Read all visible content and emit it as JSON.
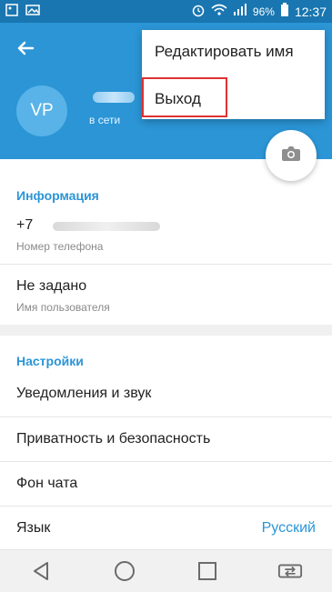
{
  "status_bar": {
    "battery": "96%",
    "time": "12:37"
  },
  "profile": {
    "avatar_initials": "VP",
    "status": "в сети"
  },
  "menu": {
    "edit_name": "Редактировать имя",
    "logout": "Выход"
  },
  "info_section": {
    "title": "Информация",
    "phone_prefix": "+7",
    "phone_label": "Номер телефона",
    "username_value": "Не задано",
    "username_label": "Имя пользователя"
  },
  "settings_section": {
    "title": "Настройки",
    "items": [
      {
        "label": "Уведомления и звук"
      },
      {
        "label": "Приватность и безопасность"
      },
      {
        "label": "Фон чата"
      },
      {
        "label": "Язык",
        "value": "Русский"
      }
    ]
  },
  "colors": {
    "primary": "#2b95d6",
    "status_bar": "#1976b0",
    "highlight": "#dd3333"
  },
  "icons": {
    "back": "arrow-left-icon",
    "camera": "camera-icon",
    "nav_back": "triangle-back-icon",
    "nav_home": "circle-home-icon",
    "nav_recent": "square-recent-icon",
    "nav_switch": "switch-icon"
  }
}
